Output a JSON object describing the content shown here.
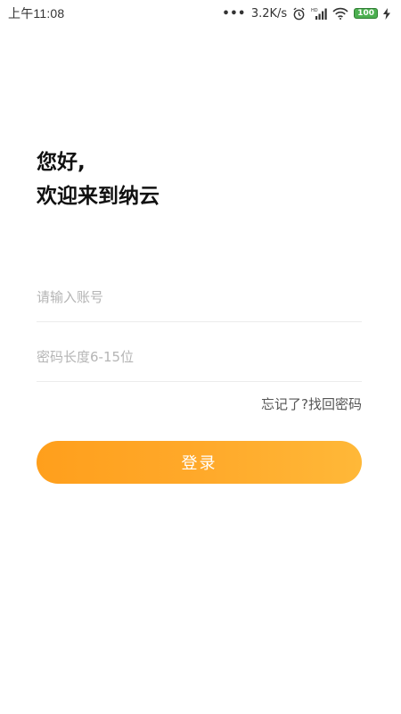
{
  "status_bar": {
    "time": "上午11:08",
    "more_dots": "•••",
    "net_speed": "3.2K/s",
    "battery_level": "100",
    "icons": [
      "alarm-icon",
      "hd-signal-icon",
      "wifi-icon",
      "battery-icon",
      "charging-icon"
    ]
  },
  "greeting": {
    "line1": "您好,",
    "line2": "欢迎来到纳云"
  },
  "form": {
    "account_placeholder": "请输入账号",
    "password_placeholder": "密码长度6-15位",
    "forgot_label": "忘记了?找回密码",
    "login_label": "登录"
  },
  "colors": {
    "accent_start": "#ff9f1c",
    "accent_end": "#ffb838",
    "battery": "#4caf50"
  }
}
